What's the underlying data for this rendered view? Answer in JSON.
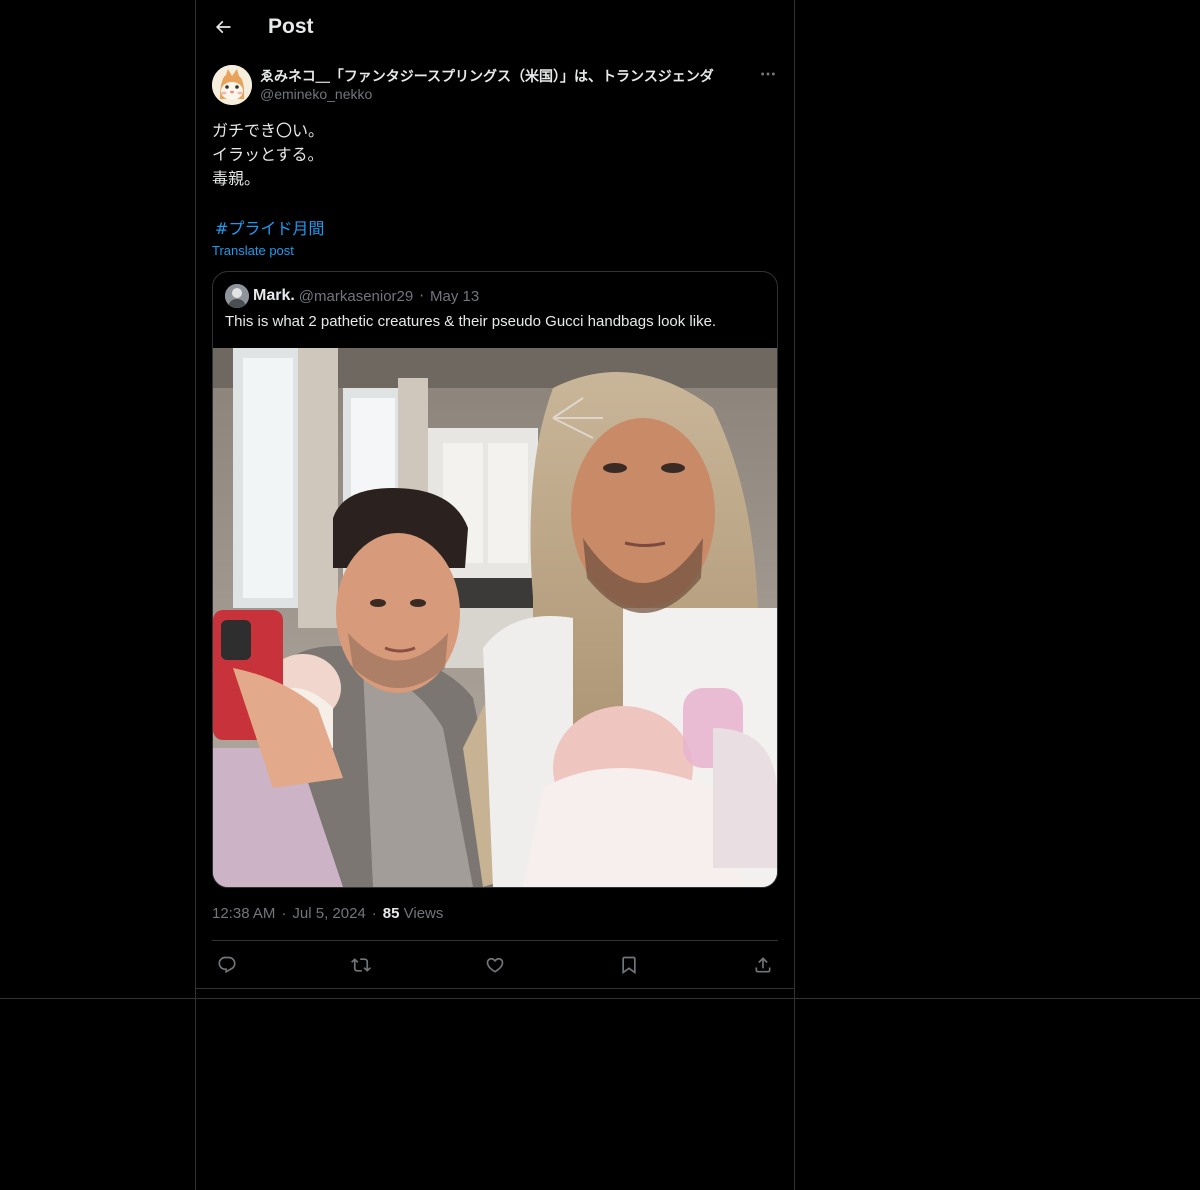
{
  "header": {
    "title": "Post",
    "back_icon": "arrow-left-icon"
  },
  "post": {
    "author_name": "ゑみネコ＿「ファンタジースプリングス（米国）」は、トランスジェンダ",
    "author_handle": "@emineko_nekko",
    "more_icon": "ellipsis-icon",
    "text_lines": [
      "ガチでき〇い。",
      "イラッとする。",
      "毒親。"
    ],
    "hashtag": "#プライド月間",
    "translate_label": "Translate post",
    "time": "12:38 AM",
    "date": "Jul 5, 2024",
    "views_count": "85",
    "views_label": "Views",
    "separator": "·"
  },
  "quote": {
    "author_name": "Mark.",
    "author_handle": "@markasenior29",
    "date": "May 13",
    "separator": "·",
    "text": "This is what 2 pathetic creatures & their pseudo Gucci handbags look like."
  },
  "actions": [
    {
      "name": "reply",
      "icon": "reply-icon"
    },
    {
      "name": "repost",
      "icon": "repost-icon"
    },
    {
      "name": "like",
      "icon": "heart-icon"
    },
    {
      "name": "bookmark",
      "icon": "bookmark-icon"
    },
    {
      "name": "share",
      "icon": "share-icon"
    }
  ],
  "colors": {
    "background": "#000000",
    "text": "#e7e9ea",
    "secondary": "#71767b",
    "accent": "#1d9bf0",
    "border": "#2f3336"
  }
}
